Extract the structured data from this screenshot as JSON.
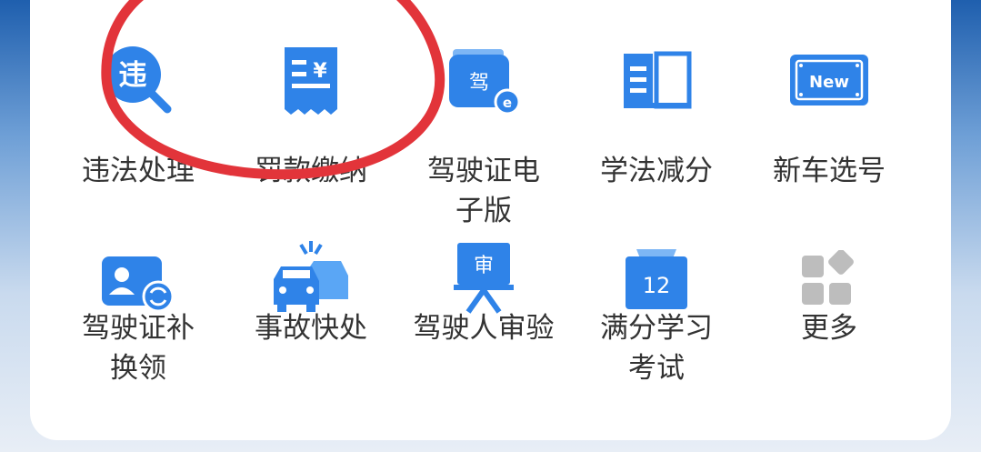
{
  "services": {
    "items": [
      {
        "label": "违法处理",
        "icon": "violation-search-icon",
        "glyph": "违"
      },
      {
        "label": "罚款缴纳",
        "icon": "fine-receipt-icon",
        "glyph": "¥"
      },
      {
        "label": "驾驶证电子版",
        "icon": "e-license-icon",
        "glyph": "驾"
      },
      {
        "label": "学法减分",
        "icon": "book-icon",
        "glyph": ""
      },
      {
        "label": "新车选号",
        "icon": "new-plate-icon",
        "glyph": "New"
      },
      {
        "label": "驾驶证补换领",
        "icon": "license-renew-icon",
        "glyph": ""
      },
      {
        "label": "事故快处",
        "icon": "accident-icon",
        "glyph": ""
      },
      {
        "label": "驾驶人审验",
        "icon": "review-easel-icon",
        "glyph": "审"
      },
      {
        "label": "满分学习考试",
        "icon": "calendar-12-icon",
        "glyph": "12"
      },
      {
        "label": "更多",
        "icon": "more-grid-icon",
        "glyph": ""
      }
    ]
  },
  "colors": {
    "primary": "#2f83e8",
    "light": "#5aa6f5",
    "annotation": "#e2343a",
    "grey": "#bdbdbd"
  }
}
